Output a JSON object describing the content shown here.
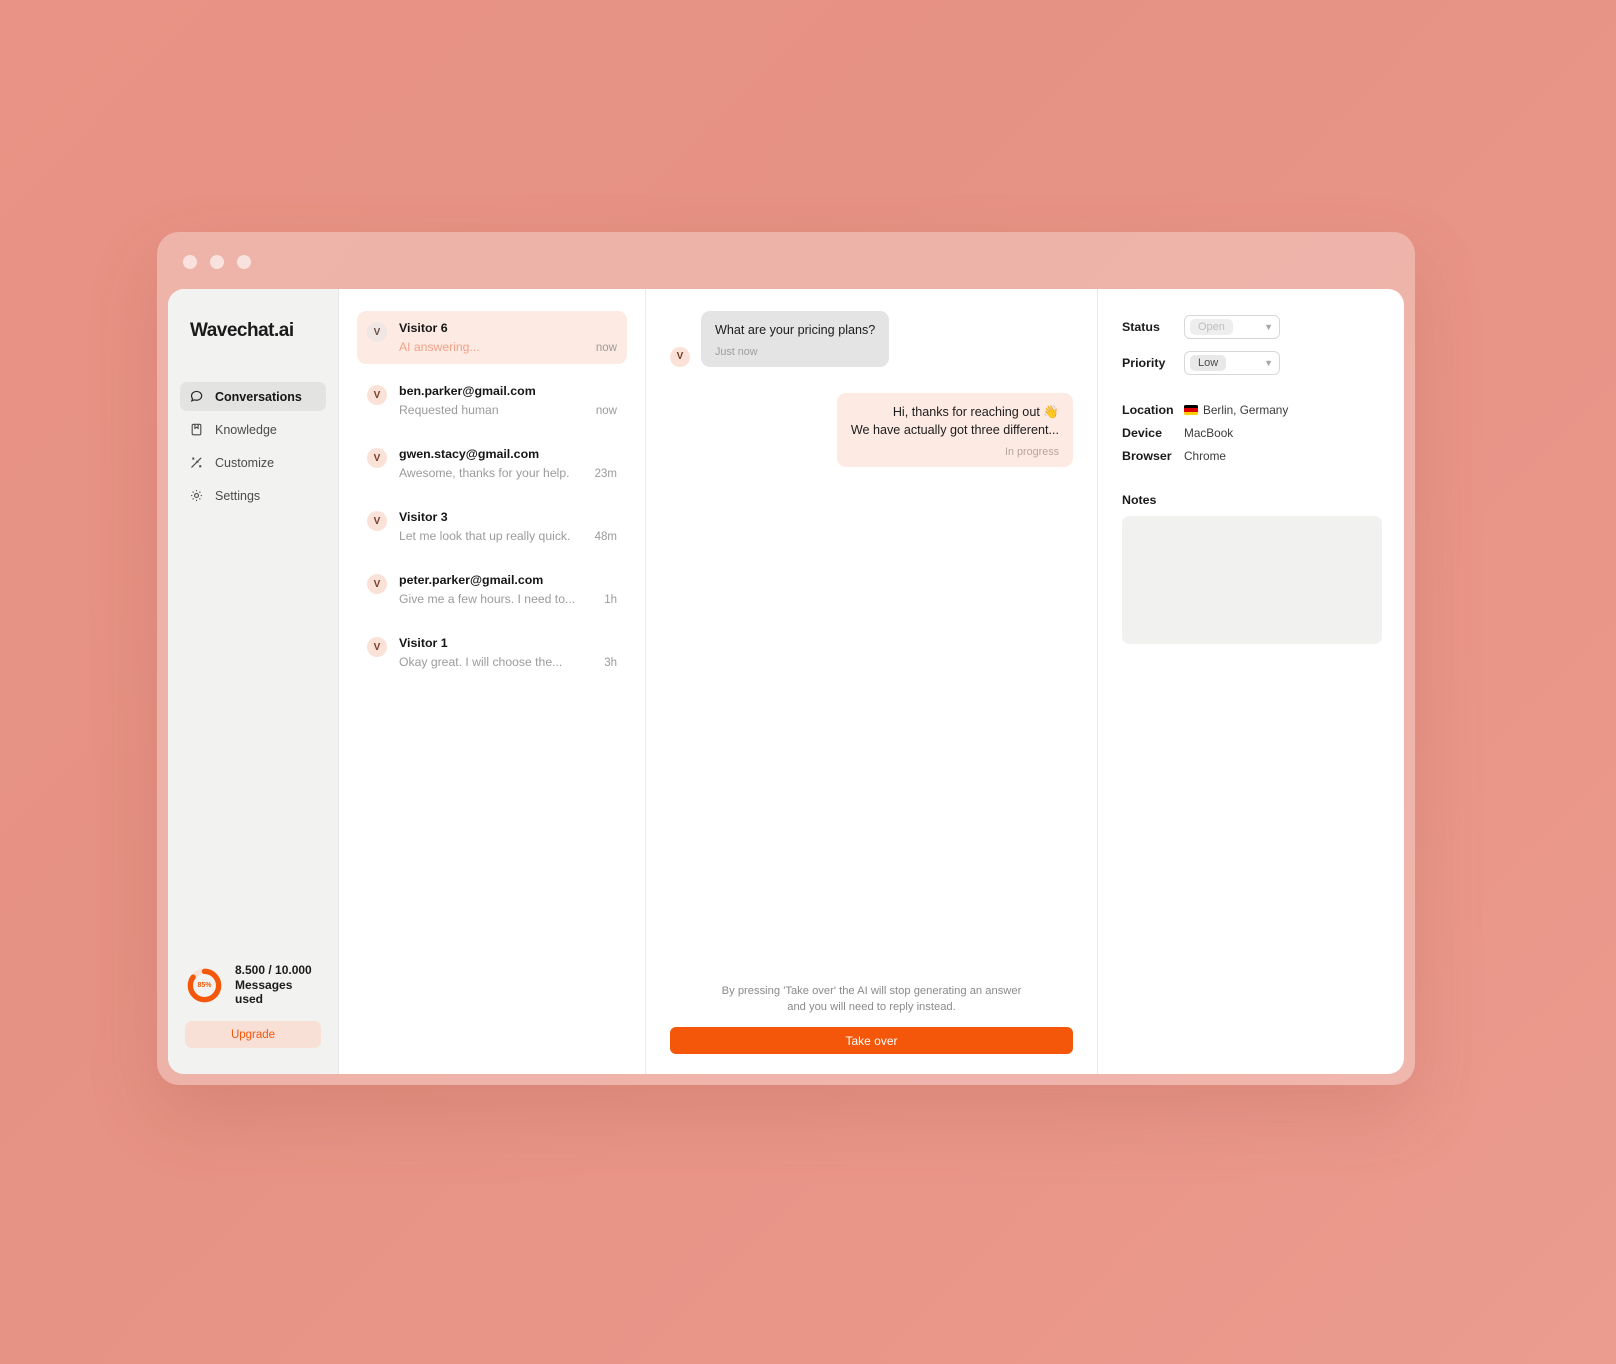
{
  "window": {
    "traffic_lights": [
      "close",
      "minimize",
      "maximize"
    ]
  },
  "sidebar": {
    "brand": "Wavechat.ai",
    "items": [
      {
        "label": "Conversations",
        "icon": "chat-bubble-icon",
        "active": true
      },
      {
        "label": "Knowledge",
        "icon": "book-icon",
        "active": false
      },
      {
        "label": "Customize",
        "icon": "wand-sparkle-icon",
        "active": false
      },
      {
        "label": "Settings",
        "icon": "gear-icon",
        "active": false
      }
    ],
    "usage": {
      "percent": "85%",
      "percent_value": 85,
      "counts": "8.500 / 10.000",
      "caption": "Messages used",
      "ring_color": "#f4560a",
      "ring_track": "#fbe0d4"
    },
    "upgrade_label": "Upgrade"
  },
  "conversations": [
    {
      "avatar": "V",
      "name": "Visitor 6",
      "preview": "AI answering...",
      "time": "now",
      "selected": true
    },
    {
      "avatar": "V",
      "name": "ben.parker@gmail.com",
      "preview": "Requested human",
      "time": "now",
      "selected": false
    },
    {
      "avatar": "V",
      "name": "gwen.stacy@gmail.com",
      "preview": "Awesome, thanks for your help.",
      "time": "23m",
      "selected": false
    },
    {
      "avatar": "V",
      "name": "Visitor 3",
      "preview": "Let me look that up really quick.",
      "time": "48m",
      "selected": false
    },
    {
      "avatar": "V",
      "name": "peter.parker@gmail.com",
      "preview": "Give me a few hours. I need to...",
      "time": "1h",
      "selected": false
    },
    {
      "avatar": "V",
      "name": "Visitor 1",
      "preview": "Okay great. I will choose the...",
      "time": "3h",
      "selected": false
    }
  ],
  "chat": {
    "incoming": {
      "avatar": "V",
      "text": "What are your pricing plans?",
      "meta": "Just now"
    },
    "outgoing": {
      "line1": "Hi, thanks for reaching out 👋",
      "line2": "We have actually got three different...",
      "meta": "In progress"
    },
    "takeover_note_line1": "By pressing 'Take over' the AI will stop generating an answer",
    "takeover_note_line2": "and you will need to reply instead.",
    "takeover_label": "Take over",
    "takeover_color": "#f4560a"
  },
  "details": {
    "status_label": "Status",
    "status_value": "Open",
    "priority_label": "Priority",
    "priority_value": "Low",
    "meta": [
      {
        "key": "Location",
        "value": "Berlin, Germany",
        "flag": "de"
      },
      {
        "key": "Device",
        "value": "MacBook",
        "flag": ""
      },
      {
        "key": "Browser",
        "value": "Chrome",
        "flag": ""
      }
    ],
    "notes_label": "Notes",
    "notes_value": "",
    "notes_placeholder": ""
  }
}
